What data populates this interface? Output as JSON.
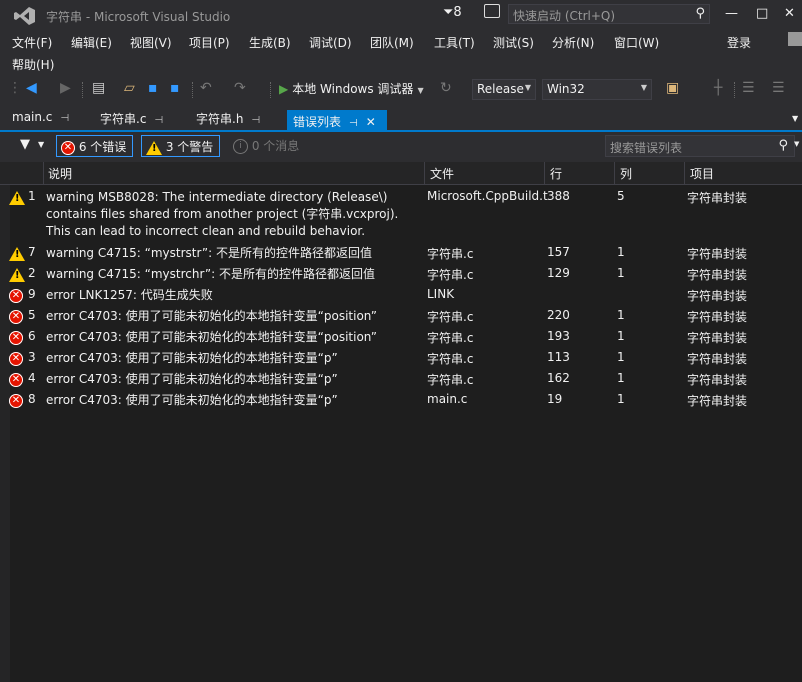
{
  "window": {
    "title": "字符串 - Microsoft Visual Studio",
    "notifications": "8",
    "quick_launch_placeholder": "快速启动 (Ctrl+Q)",
    "controls": [
      "—",
      "□",
      "✕"
    ]
  },
  "menu": {
    "items": [
      "文件(F)",
      "编辑(E)",
      "视图(V)",
      "项目(P)",
      "生成(B)",
      "调试(D)",
      "团队(M)",
      "工具(T)",
      "测试(S)",
      "分析(N)",
      "窗口(W)",
      "帮助(H)"
    ],
    "login": "登录"
  },
  "toolbar": {
    "run_label": "本地 Windows 调试器",
    "configuration": "Release",
    "platform": "Win32"
  },
  "tabs": {
    "items": [
      "main.c",
      "字符串.c",
      "字符串.h"
    ],
    "active": "错误列表"
  },
  "error_list": {
    "errors_label": "6 个错误",
    "warnings_label": "3 个警告",
    "messages_label": "0 个消息",
    "search_placeholder": "搜索错误列表",
    "columns": [
      "说明",
      "文件",
      "行",
      "列",
      "项目"
    ],
    "rows": [
      {
        "type": "warning",
        "num": "1",
        "desc": "warning MSB8028: The intermediate directory (Release\\) contains files shared from another project (字符串.vcxproj).  This can lead to incorrect clean and rebuild behavior.",
        "file": "Microsoft.CppBuild.t",
        "line": "388",
        "col": "5",
        "project": "字符串封装"
      },
      {
        "type": "warning",
        "num": "7",
        "desc": "warning C4715: “mystrstr”: 不是所有的控件路径都返回值",
        "file": "字符串.c",
        "line": "157",
        "col": "1",
        "project": "字符串封装"
      },
      {
        "type": "warning",
        "num": "2",
        "desc": "warning C4715: “mystrchr”: 不是所有的控件路径都返回值",
        "file": "字符串.c",
        "line": "129",
        "col": "1",
        "project": "字符串封装"
      },
      {
        "type": "error",
        "num": "9",
        "desc": "error LNK1257: 代码生成失败",
        "file": "LINK",
        "line": "",
        "col": "",
        "project": "字符串封装"
      },
      {
        "type": "error",
        "num": "5",
        "desc": "error C4703: 使用了可能未初始化的本地指针变量“position”",
        "file": "字符串.c",
        "line": "220",
        "col": "1",
        "project": "字符串封装"
      },
      {
        "type": "error",
        "num": "6",
        "desc": "error C4703: 使用了可能未初始化的本地指针变量“position”",
        "file": "字符串.c",
        "line": "193",
        "col": "1",
        "project": "字符串封装"
      },
      {
        "type": "error",
        "num": "3",
        "desc": "error C4703: 使用了可能未初始化的本地指针变量“p”",
        "file": "字符串.c",
        "line": "113",
        "col": "1",
        "project": "字符串封装"
      },
      {
        "type": "error",
        "num": "4",
        "desc": "error C4703: 使用了可能未初始化的本地指针变量“p”",
        "file": "字符串.c",
        "line": "162",
        "col": "1",
        "project": "字符串封装"
      },
      {
        "type": "error",
        "num": "8",
        "desc": "error C4703: 使用了可能未初始化的本地指针变量“p”",
        "file": "main.c",
        "line": "19",
        "col": "1",
        "project": "字符串封装"
      }
    ]
  },
  "colors": {
    "accent": "#007acc",
    "error": "#e51400",
    "warning": "#ffcc00",
    "background": "#1e1e1e"
  }
}
